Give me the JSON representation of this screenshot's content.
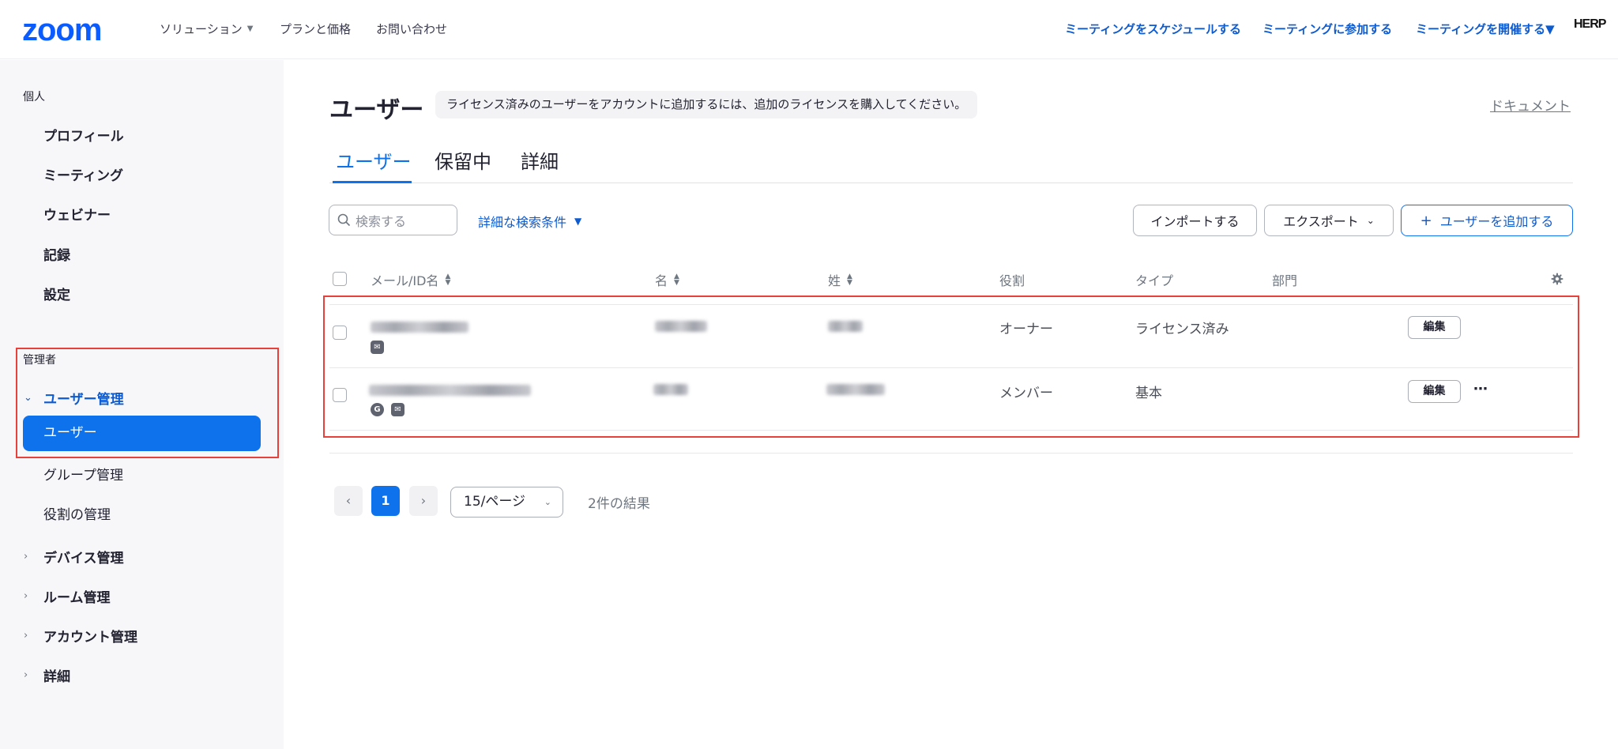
{
  "header": {
    "logo": "zoom",
    "nav": [
      {
        "label": "ソリューション",
        "has_caret": true
      },
      {
        "label": "プランと価格"
      },
      {
        "label": "お問い合わせ"
      }
    ],
    "right_nav": [
      {
        "label": "ミーティングをスケジュールする"
      },
      {
        "label": "ミーティングに参加する"
      },
      {
        "label": "ミーティングを開催する",
        "has_caret": true
      }
    ],
    "account_logo": "HERP"
  },
  "sidebar": {
    "personal_title": "個人",
    "personal_items": [
      "プロフィール",
      "ミーティング",
      "ウェビナー",
      "記録",
      "設定"
    ],
    "admin_title": "管理者",
    "user_mgmt": "ユーザー管理",
    "user_mgmt_items": [
      "ユーザー",
      "グループ管理",
      "役割の管理"
    ],
    "groups": [
      "デバイス管理",
      "ルーム管理",
      "アカウント管理",
      "詳細"
    ]
  },
  "main": {
    "title": "ユーザー",
    "notice": "ライセンス済みのユーザーをアカウントに追加するには、追加のライセンスを購入してください。",
    "doc_link": "ドキュメント",
    "tabs": [
      "ユーザー",
      "保留中",
      "詳細"
    ],
    "active_tab": 0,
    "search_placeholder": "検索する",
    "advanced_search": "詳細な検索条件",
    "import_button": "インポートする",
    "export_button": "エクスポート",
    "add_user_button": "ユーザーを追加する",
    "columns": [
      "メール/ID名",
      "名",
      "姓",
      "役割",
      "タイプ",
      "部門"
    ],
    "rows": [
      {
        "role": "オーナー",
        "type": "ライセンス済み",
        "edit": "編集"
      },
      {
        "role": "メンバー",
        "type": "基本",
        "edit": "編集"
      }
    ],
    "pagination": {
      "current": "1",
      "per_page": "15/ページ",
      "result": "2件の結果"
    }
  },
  "colors": {
    "accent": "#0e72ed",
    "link": "#0e5bcf",
    "highlight_box": "#e8413b",
    "sidebar_bg": "#f7f7fa"
  }
}
